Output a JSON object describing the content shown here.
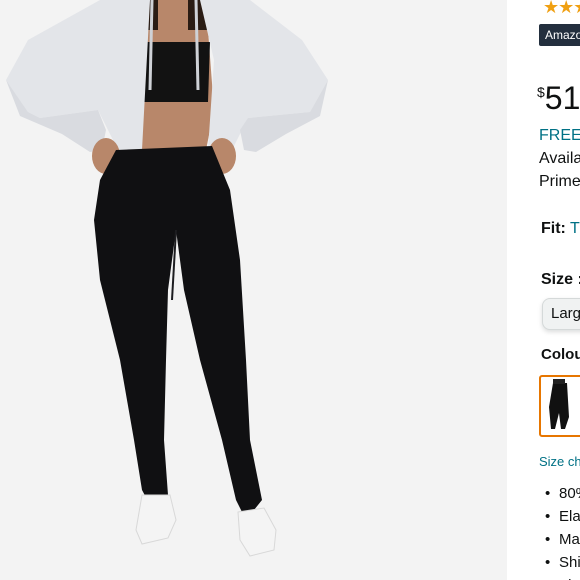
{
  "rating": {
    "stars": "★★★"
  },
  "badge": "Amazon's Choice",
  "price": {
    "symbol": "$",
    "whole": "51"
  },
  "delivery": {
    "free": "FREE",
    "availability": "Available",
    "prime": "Prime"
  },
  "fit": {
    "label": "Fit:",
    "value": "True to size"
  },
  "size": {
    "label": "Size :",
    "selected": "Large"
  },
  "colour": {
    "label": "Colour"
  },
  "size_chart": "Size chart",
  "bullets": [
    "80%",
    "Elastic",
    "Ma",
    "Shi",
    "Fl"
  ],
  "colors": {
    "link": "#007185",
    "star": "#f0a012",
    "swatch_border": "#e77600",
    "badge_bg": "#232f3e"
  }
}
